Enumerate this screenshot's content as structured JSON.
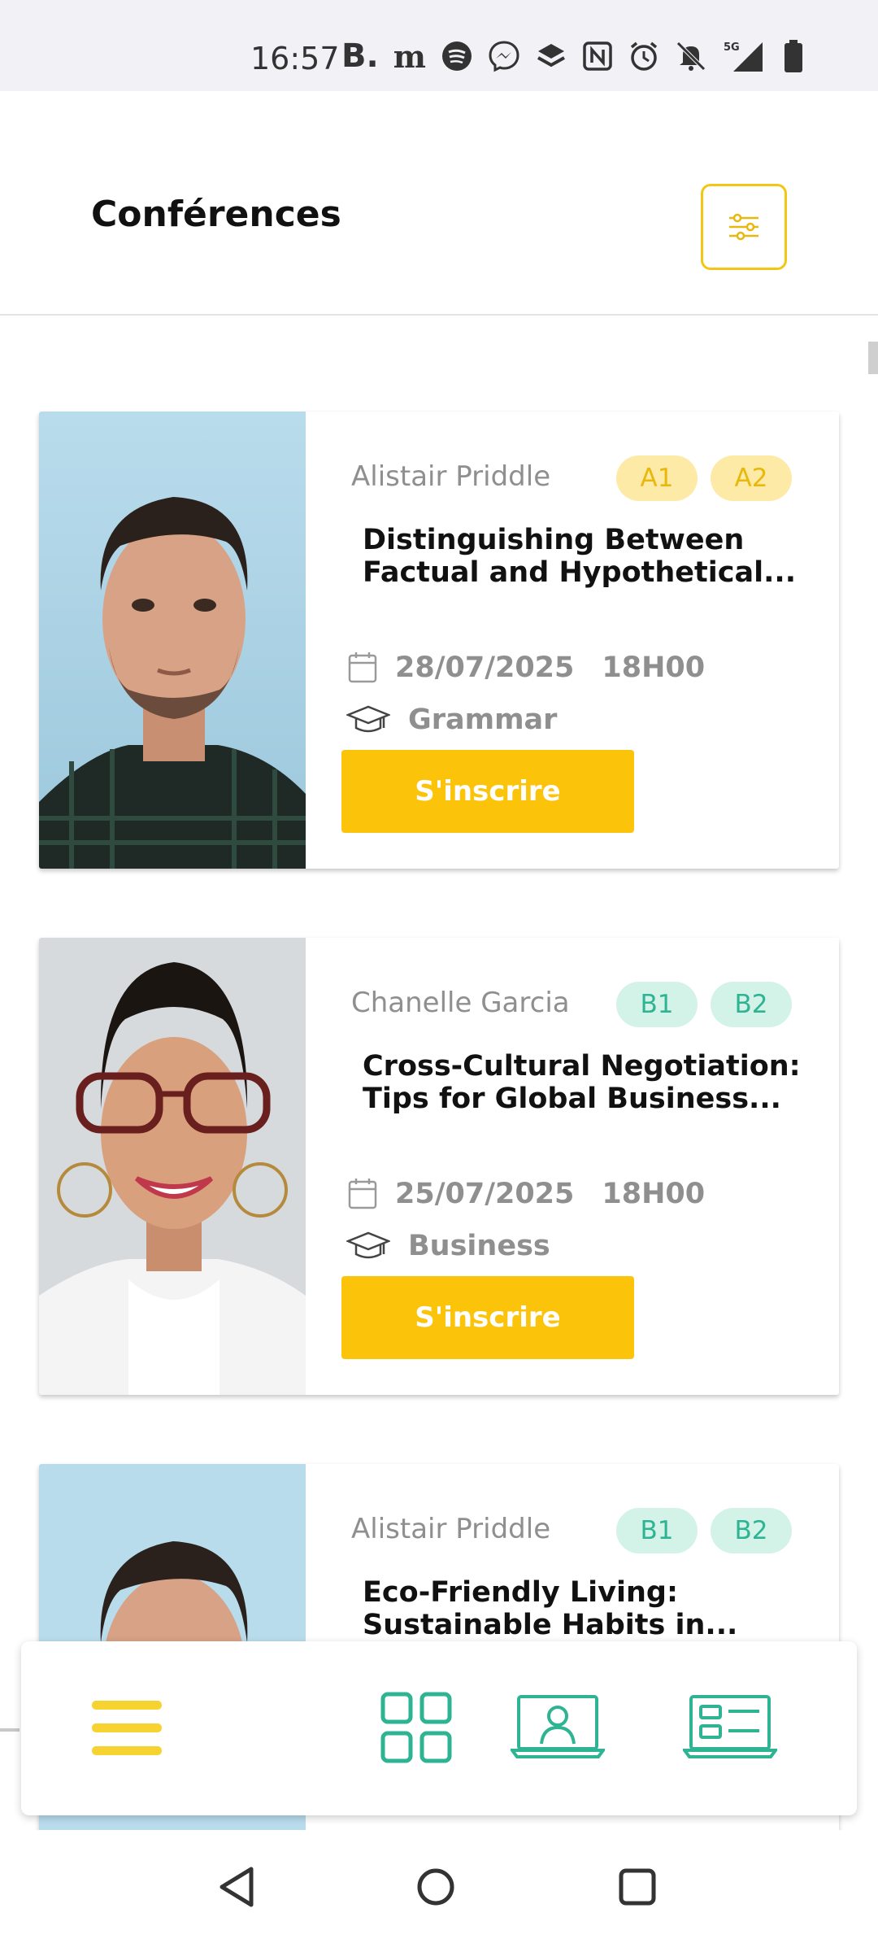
{
  "status_bar": {
    "time": "16:57",
    "icons": [
      "booking-icon",
      "lemonde-icon",
      "spotify-icon",
      "messenger-icon",
      "layers-icon",
      "nfc-icon",
      "alarm-icon",
      "mute-icon",
      "signal-5g-icon",
      "battery-icon"
    ],
    "booking_glyph": "B.",
    "lemonde_glyph": "m"
  },
  "header": {
    "title": "Conférences"
  },
  "cards": [
    {
      "speaker": "Alistair Priddle",
      "levels": [
        "A1",
        "A2"
      ],
      "level_color": "yellow",
      "title_line1": "Distinguishing Between",
      "title_line2": "Factual and Hypothetical...",
      "date": "28/07/2025",
      "time": "18H00",
      "category": "Grammar",
      "button": "S'inscrire"
    },
    {
      "speaker": "Chanelle Garcia",
      "levels": [
        "B1",
        "B2"
      ],
      "level_color": "green",
      "title_line1": "Cross-Cultural Negotiation:",
      "title_line2": "Tips for Global Business...",
      "date": "25/07/2025",
      "time": "18H00",
      "category": "Business",
      "button": "S'inscrire"
    },
    {
      "speaker": "Alistair Priddle",
      "levels": [
        "B1",
        "B2"
      ],
      "level_color": "green",
      "title_line1": "Eco-Friendly Living:",
      "title_line2": "Sustainable Habits in..."
    }
  ],
  "bottom_nav": {
    "items": [
      "menu-icon",
      "grid-icon",
      "online-conference-icon",
      "list-card-icon"
    ]
  },
  "colors": {
    "accent_yellow": "#fcc30b",
    "accent_green": "#2fb493",
    "muted_text": "#8f8f8f"
  }
}
